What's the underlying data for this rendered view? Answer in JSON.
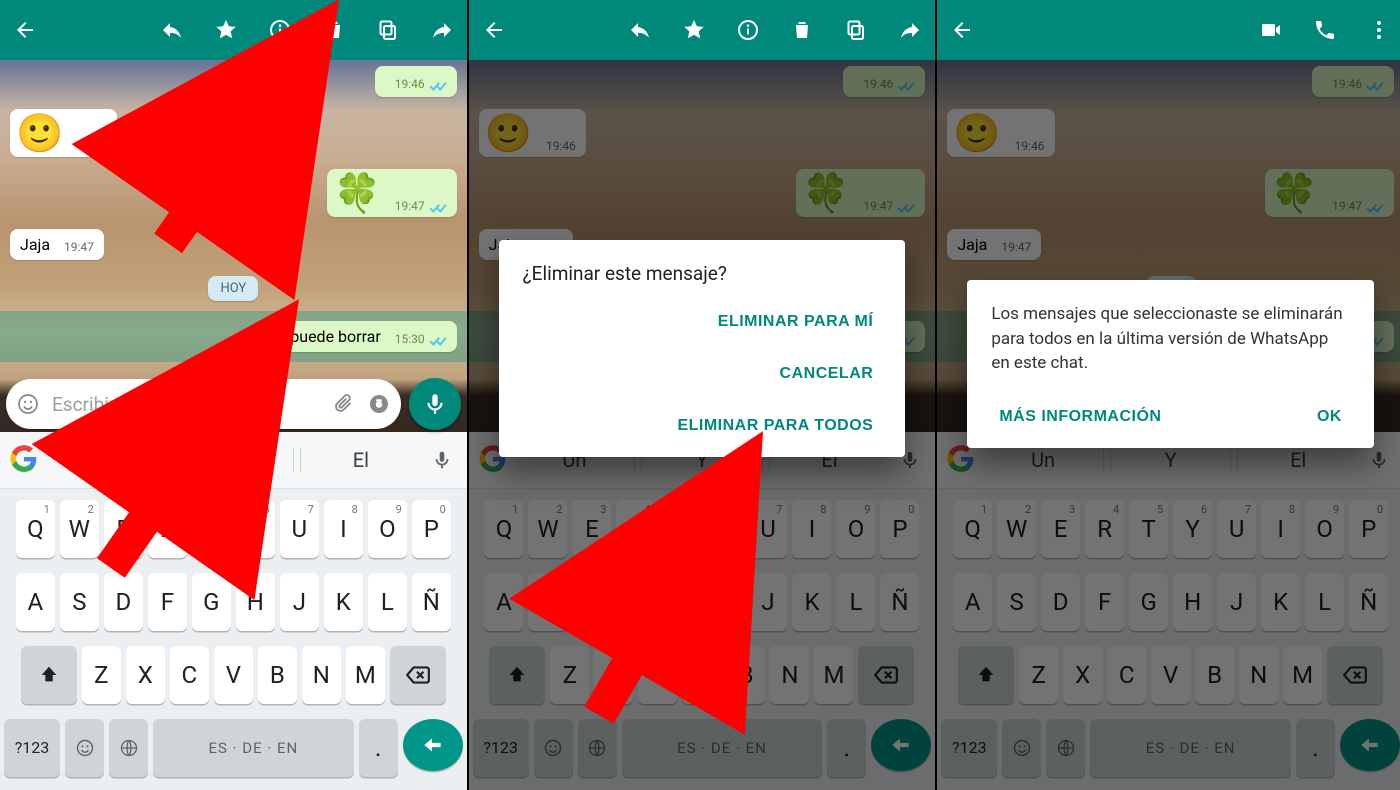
{
  "panels": [
    {
      "mode": "selection",
      "dim": false
    },
    {
      "mode": "selection",
      "dim": true
    },
    {
      "mode": "chat",
      "dim": true
    }
  ],
  "actionbar_selection_icons": [
    "back",
    "reply",
    "star",
    "info",
    "trash",
    "copy",
    "forward"
  ],
  "actionbar_chat_icons": [
    "back_small",
    "video",
    "phone",
    "more"
  ],
  "chat": {
    "bubble1": {
      "time": "19:46"
    },
    "bubble2_emoji": "🙂",
    "bubble2": {
      "time": "19:46"
    },
    "bubble3_emoji": "🍀",
    "bubble3": {
      "time": "19:47"
    },
    "bubble4": {
      "text": "Jaja",
      "time": "19:47"
    },
    "datepill": "HOY",
    "bubble5": {
      "text": "Se puede borrar",
      "time": "15:30"
    }
  },
  "input": {
    "placeholder": "Escribir respuesta…"
  },
  "keyboard": {
    "suggestions": [
      "Un",
      "Y",
      "El"
    ],
    "row1": [
      [
        "Q",
        "1"
      ],
      [
        "W",
        "2"
      ],
      [
        "E",
        "3"
      ],
      [
        "R",
        "4"
      ],
      [
        "T",
        "5"
      ],
      [
        "Y",
        "6"
      ],
      [
        "U",
        "7"
      ],
      [
        "I",
        "8"
      ],
      [
        "O",
        "9"
      ],
      [
        "P",
        "0"
      ]
    ],
    "row2": [
      "A",
      "S",
      "D",
      "F",
      "G",
      "H",
      "J",
      "K",
      "L",
      "Ñ"
    ],
    "row3": [
      "Z",
      "X",
      "C",
      "V",
      "B",
      "N",
      "M"
    ],
    "sym": "?123",
    "lang_label": "ES · DE · EN"
  },
  "dialog_delete": {
    "title": "¿Eliminar este mensaje?",
    "opt_me": "ELIMINAR PARA MÍ",
    "opt_cancel": "CANCELAR",
    "opt_all": "ELIMINAR PARA TODOS"
  },
  "dialog_info": {
    "body": "Los mensajes que seleccionaste se eliminarán para todos en la última versión de WhatsApp en este chat.",
    "btn_more": "MÁS INFORMACIÓN",
    "btn_ok": "OK"
  }
}
